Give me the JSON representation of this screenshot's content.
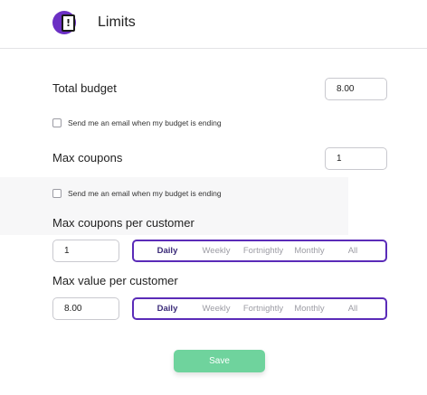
{
  "header": {
    "title": "Limits",
    "logo_glyph": "!",
    "accent_color": "#6b2fc4"
  },
  "total_budget": {
    "label": "Total budget",
    "value": "8.00",
    "email_checkbox_label": "Send me an email when my budget is ending",
    "email_checked": false
  },
  "max_coupons": {
    "label": "Max coupons",
    "value": "1",
    "email_checkbox_label": "Send me an email when my budget is ending",
    "email_checked": false
  },
  "max_coupons_per_customer": {
    "label": "Max coupons per customer",
    "value": "1",
    "periods": [
      "Daily",
      "Weekly",
      "Fortnightly",
      "Monthly",
      "All"
    ],
    "selected_period": "Daily"
  },
  "max_value_per_customer": {
    "label": "Max value per customer",
    "value": "8.00",
    "periods": [
      "Daily",
      "Weekly",
      "Fortnightly",
      "Monthly",
      "All"
    ],
    "selected_period": "Daily"
  },
  "save_button": {
    "label": "Save",
    "color": "#6fd39d"
  },
  "colors": {
    "period_border": "#5a2bb8",
    "inactive_text": "#9c9ca4"
  }
}
